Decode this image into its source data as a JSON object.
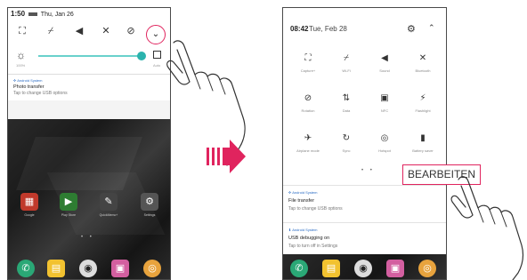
{
  "left_phone": {
    "status_time": "1:50",
    "status_date": "Thu, Jan 26",
    "quick_icons": [
      "nfc-icon",
      "wifi-off-icon",
      "sound-icon",
      "bluetooth-off-icon",
      "rotation-icon"
    ],
    "brightness_pct_label": "100%",
    "auto_label": "Auto",
    "brightness_level": 0.95,
    "notification": {
      "app": "Android System",
      "title": "Photo transfer",
      "subtitle": "Tap to change USB options"
    },
    "home_apps": [
      {
        "label": "Google",
        "icon": "google-folder-icon",
        "color": "#c0392b"
      },
      {
        "label": "Play Store",
        "icon": "play-store-icon",
        "color": "#2e7d32"
      },
      {
        "label": "QuickMemo+",
        "icon": "quickmemo-icon",
        "color": "#444444"
      },
      {
        "label": "Settings",
        "icon": "settings-icon",
        "color": "#555555"
      }
    ],
    "dock_icons": [
      "phone-icon",
      "messages-icon",
      "camera-icon",
      "gallery-icon",
      "chrome-icon"
    ]
  },
  "right_phone": {
    "time": "08:42",
    "date": "Tue, Feb 28",
    "tiles": [
      {
        "label": "Capture+",
        "icon": "capture-icon"
      },
      {
        "label": "Wi-Fi",
        "icon": "wifi-off-icon"
      },
      {
        "label": "Sound",
        "icon": "sound-icon"
      },
      {
        "label": "Bluetooth",
        "icon": "bluetooth-off-icon"
      },
      {
        "label": "Rotation",
        "icon": "rotation-icon"
      },
      {
        "label": "Data",
        "icon": "data-off-icon"
      },
      {
        "label": "NFC",
        "icon": "nfc-icon"
      },
      {
        "label": "Flashlight",
        "icon": "flashlight-icon"
      },
      {
        "label": "Airplane mode",
        "icon": "airplane-off-icon"
      },
      {
        "label": "Sync",
        "icon": "sync-icon"
      },
      {
        "label": "Hotspot",
        "icon": "hotspot-icon"
      },
      {
        "label": "Battery saver",
        "icon": "battery-saver-icon"
      }
    ],
    "edit_label": "BEARBEITEN",
    "notifications": [
      {
        "app": "Android System",
        "title": "File transfer",
        "subtitle": "Tap to change USB options"
      },
      {
        "app": "Android System",
        "title": "USB debugging on",
        "subtitle": "Tap to turn off in Settings"
      }
    ],
    "dock_icons": [
      "phone-icon",
      "messages-icon",
      "camera-icon",
      "gallery-icon",
      "chrome-icon"
    ]
  },
  "colors": {
    "highlight": "#e0245e",
    "slider": "#2bb3ad",
    "arrow": "#e0245e"
  }
}
